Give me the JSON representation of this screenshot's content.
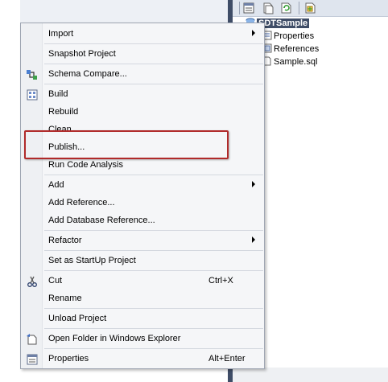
{
  "solution_explorer": {
    "project_name": "SDTSample",
    "items": [
      {
        "label": "Properties",
        "icon": "properties-icon"
      },
      {
        "label": "References",
        "icon": "references-icon"
      },
      {
        "label": "Sample.sql",
        "icon": "sql-file-icon"
      }
    ],
    "toolbar_icons": [
      "properties-window-icon",
      "show-all-files-icon",
      "refresh-icon",
      "schema-view-icon"
    ]
  },
  "menu": {
    "items": [
      {
        "label": "Import",
        "submenu": true
      },
      {
        "label": "Snapshot Project"
      },
      {
        "label": "Schema Compare...",
        "icon": "schema-compare-icon"
      },
      {
        "label": "Build",
        "icon": "build-icon"
      },
      {
        "label": "Rebuild"
      },
      {
        "label": "Clean"
      },
      {
        "label": "Publish..."
      },
      {
        "label": "Run Code Analysis"
      },
      {
        "label": "Add",
        "submenu": true
      },
      {
        "label": "Add Reference..."
      },
      {
        "label": "Add Database Reference..."
      },
      {
        "label": "Refactor",
        "submenu": true
      },
      {
        "label": "Set as StartUp Project"
      },
      {
        "label": "Cut",
        "shortcut": "Ctrl+X",
        "icon": "scissors-icon"
      },
      {
        "label": "Rename"
      },
      {
        "label": "Unload Project"
      },
      {
        "label": "Open Folder in Windows Explorer",
        "icon": "open-folder-icon"
      },
      {
        "label": "Properties",
        "shortcut": "Alt+Enter",
        "icon": "properties-icon"
      }
    ]
  },
  "colors": {
    "highlight_border": "#b02a2a",
    "selected_bg": "#3f4d67",
    "menu_bg": "#f5f6f8"
  }
}
